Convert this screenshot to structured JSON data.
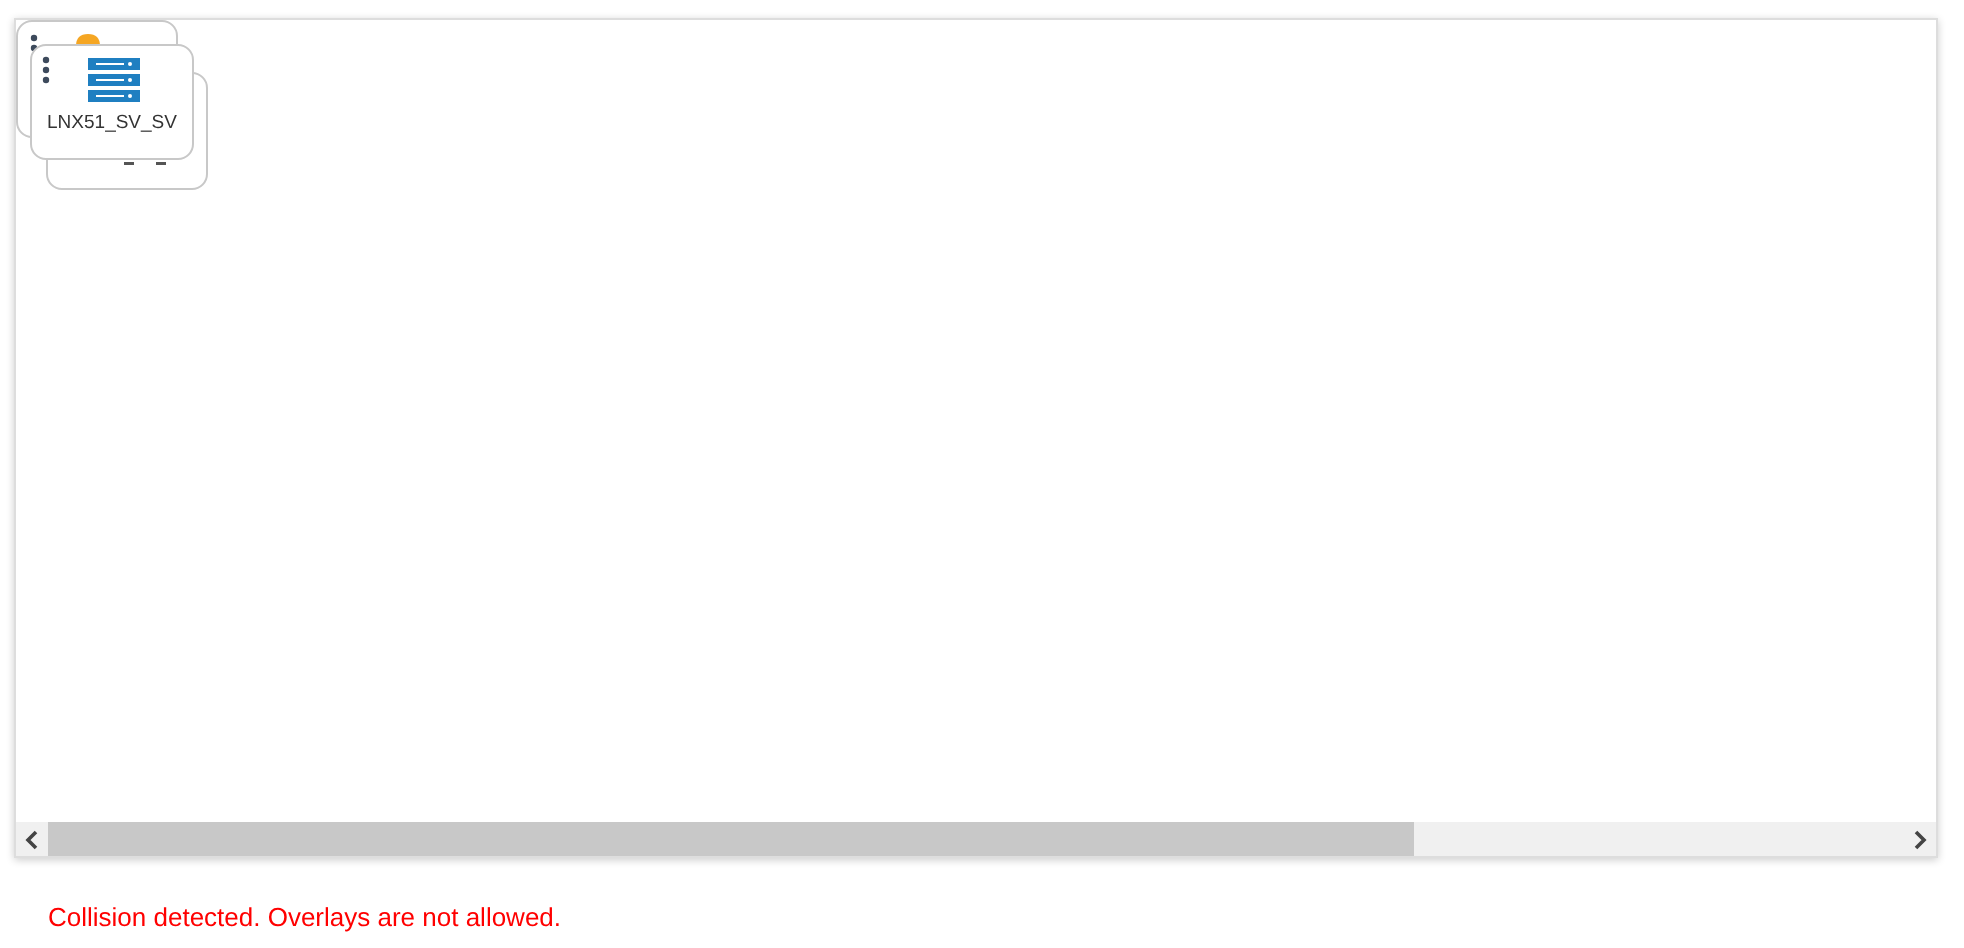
{
  "canvas": {
    "nodes": [
      {
        "kind": "stub-orange"
      },
      {
        "kind": "stub-plain"
      },
      {
        "kind": "server",
        "label": "LNX51_SV_SV"
      }
    ]
  },
  "error_message": "Collision detected. Overlays are not allowed."
}
